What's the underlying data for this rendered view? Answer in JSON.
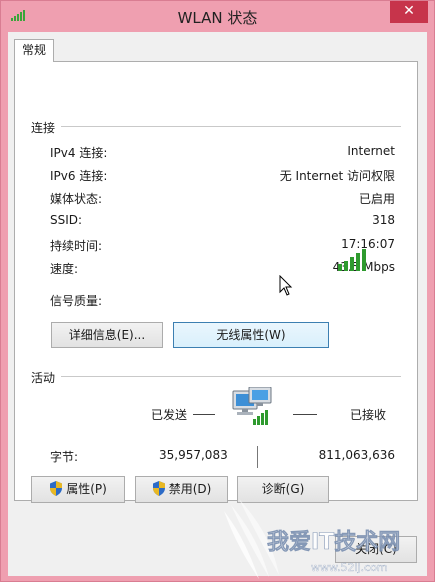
{
  "window": {
    "title": "WLAN 状态",
    "close_glyph": "✕"
  },
  "tab": {
    "label": "常规"
  },
  "connection": {
    "section_label": "连接",
    "rows": [
      {
        "label": "IPv4 连接:",
        "value": "Internet"
      },
      {
        "label": "IPv6 连接:",
        "value": "无 Internet 访问权限"
      },
      {
        "label": "媒体状态:",
        "value": "已启用"
      },
      {
        "label": "SSID:",
        "value": "318"
      },
      {
        "label": "持续时间:",
        "value": "17:16:07"
      },
      {
        "label": "速度:",
        "value": "43.5 Mbps"
      }
    ],
    "signal_label": "信号质量:",
    "signal_bars": 5,
    "signal_bars_total": 5,
    "details_button": "详细信息(E)...",
    "wireless_props_button": "无线属性(W)"
  },
  "activity": {
    "section_label": "活动",
    "sent_label": "已发送",
    "received_label": "已接收",
    "bytes_label": "字节:",
    "bytes_sent": "35,957,083",
    "bytes_received": "811,063,636"
  },
  "buttons": {
    "properties": "属性(P)",
    "disable": "禁用(D)",
    "diagnose": "诊断(G)",
    "close": "关闭(C)"
  },
  "watermark": {
    "text": "我爱IT技术网",
    "url": "www.52ij.com"
  },
  "colors": {
    "window_frame": "#ef9fb0",
    "close_button": "#c7344b",
    "signal_green": "#3aa53a"
  },
  "icons": {
    "title": "wifi-signal-icon",
    "signal": "signal-strength-icon",
    "network": "network-computers-icon",
    "shield": "uac-shield-icon",
    "cursor": "mouse-pointer-icon"
  }
}
